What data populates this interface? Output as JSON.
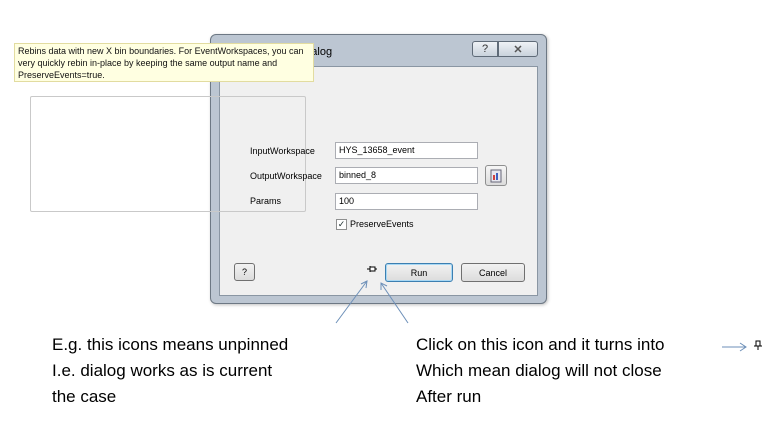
{
  "dialog": {
    "title": "Rebin input dialog",
    "help_title_label": "?",
    "close_label": "✕",
    "description": "Rebins data with new X bin boundaries. For EventWorkspaces, you can very quickly rebin in-place by keeping the same output name and PreserveEvents=true.",
    "fields": {
      "input_workspace": {
        "label": "InputWorkspace",
        "value": "HYS_13658_event"
      },
      "output_workspace": {
        "label": "OutputWorkspace",
        "value": "binned_8"
      },
      "params": {
        "label": "Params",
        "value": "100"
      }
    },
    "preserve_events": {
      "label": "PreserveEvents",
      "checked": true
    },
    "buttons": {
      "help": "?",
      "run": "Run",
      "cancel": "Cancel"
    },
    "pin_icon": "pin-unpinned-icon"
  },
  "annotations": {
    "left": [
      "E.g. this icons means unpinned",
      "I.e. dialog works as is current",
      "the case"
    ],
    "right": [
      "Click on this icon and it turns into",
      "Which mean dialog will not close",
      "After run"
    ],
    "arrow_right_target_icon": "pin-pinned-icon"
  },
  "colors": {
    "window_frame": "#bcc6d2",
    "info_background": "#ffffe1",
    "run_border": "#3c7fb1",
    "arrow": "#6c8fb8"
  }
}
